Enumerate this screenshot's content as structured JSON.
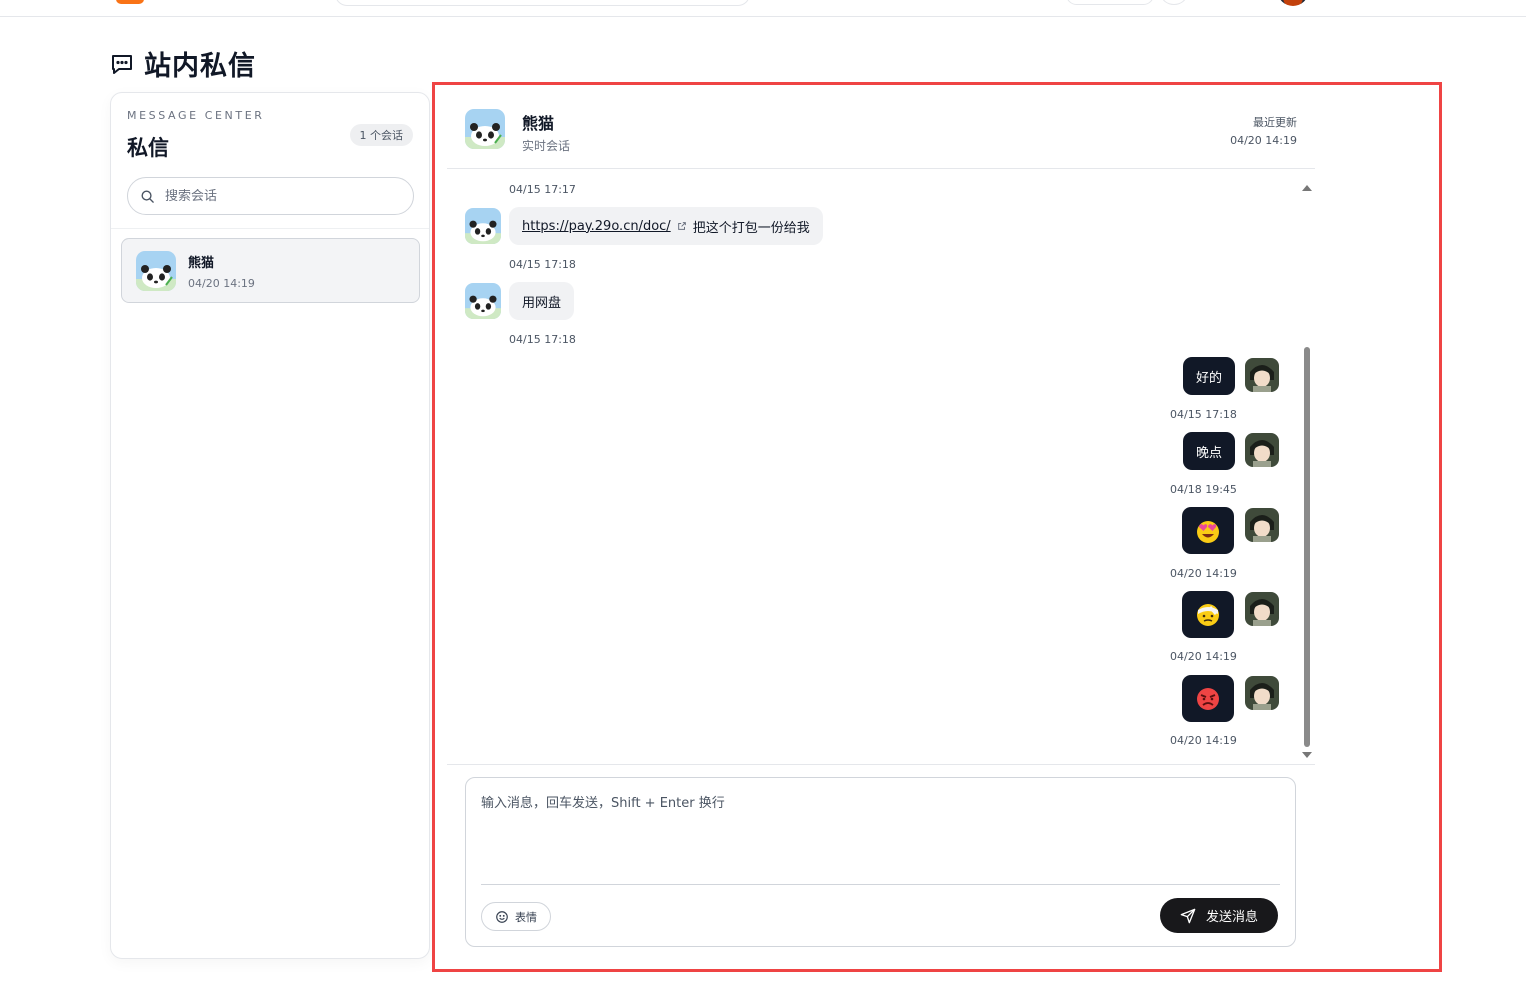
{
  "page": {
    "title": "站内私信"
  },
  "sidebar": {
    "eyebrow": "MESSAGE CENTER",
    "title": "私信",
    "count_badge": "1 个会话",
    "search_placeholder": "搜索会话",
    "conversations": [
      {
        "name": "熊猫",
        "time": "04/20 14:19"
      }
    ]
  },
  "chat": {
    "header": {
      "name": "熊猫",
      "subtitle": "实时会话",
      "updated_label": "最近更新",
      "updated_time": "04/20 14:19"
    },
    "messages": [
      {
        "side": "in",
        "time": "04/15 17:17",
        "link": "https://pay.29o.cn/doc/",
        "text": "把这个打包一份给我"
      },
      {
        "side": "in",
        "time": "04/15 17:18",
        "text": "用网盘"
      },
      {
        "side": "out",
        "time": "04/15 17:18",
        "text": "好的"
      },
      {
        "side": "out",
        "time": "04/15 17:18",
        "text": "晚点"
      },
      {
        "side": "out",
        "time": "04/18 19:45",
        "emoji": "heart-eyes-face"
      },
      {
        "side": "out",
        "time": "04/20 14:19",
        "emoji": "bandage-face"
      },
      {
        "side": "out",
        "time": "04/20 14:19",
        "emoji": "angry-face"
      }
    ],
    "composer": {
      "placeholder": "输入消息，回车发送，Shift + Enter 换行",
      "emoji_label": "表情",
      "send_label": "发送消息"
    }
  }
}
